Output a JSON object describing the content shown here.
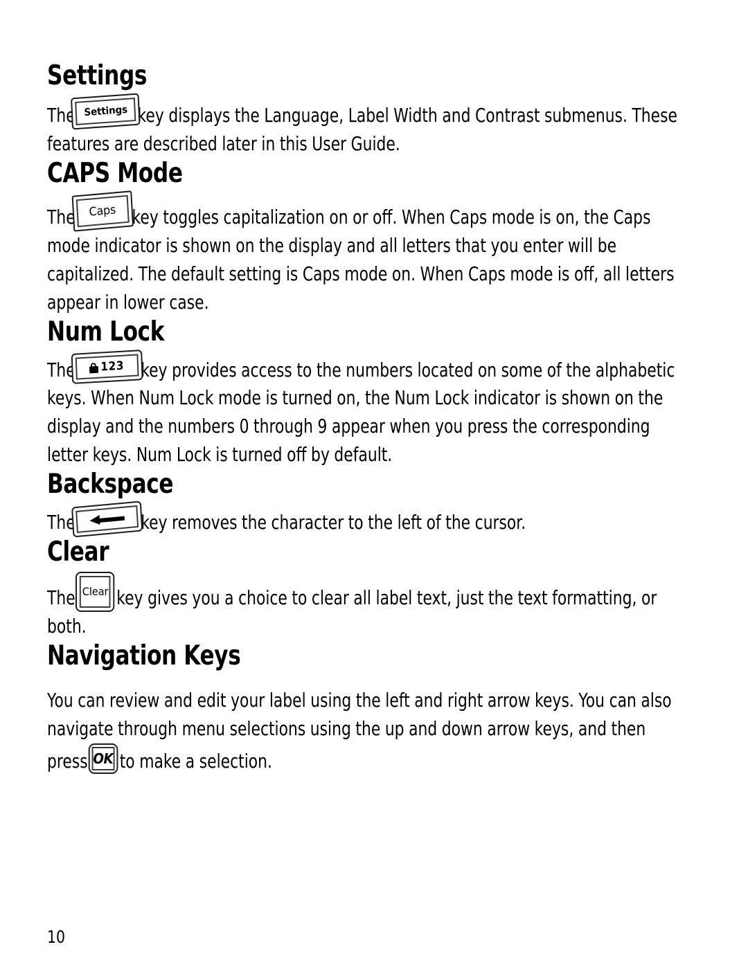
{
  "page": {
    "page_number": "10",
    "background_color": "#ffffff",
    "text_color": "#000000"
  },
  "sections": [
    {
      "id": "settings",
      "heading": "Settings",
      "key_icon": "settings-key-icon",
      "key_label": "Settings",
      "text_before": "The",
      "text_after": "key displays the Language, Label Width and Contrast submenus. These features are described later in this User Guide."
    },
    {
      "id": "caps-mode",
      "heading": "CAPS Mode",
      "key_icon": "caps-key-icon",
      "key_label": "Caps",
      "text_before": "The",
      "text_after": "key toggles capitalization on or off. When Caps mode is on, the Caps mode indicator is shown on the display and all letters that you enter will be capitalized. The default setting is Caps mode on. When Caps mode is off, all letters appear in lower case."
    },
    {
      "id": "num-lock",
      "heading": "Num Lock",
      "key_icon": "num-lock-key-icon",
      "key_label": "123",
      "text_before": "The",
      "text_after": "key provides access to the numbers located on some of the alphabetic keys. When Num Lock mode is turned on, the Num Lock indicator is shown on the display and the numbers 0 through 9 appear when you press the corresponding letter keys. Num Lock is turned off by default."
    },
    {
      "id": "backspace",
      "heading": "Backspace",
      "key_icon": "backspace-key-icon",
      "key_label": "",
      "text_before": "The",
      "text_after": "key removes the character to the left of the cursor."
    },
    {
      "id": "clear",
      "heading": "Clear",
      "key_icon": "clear-key-icon",
      "key_label": "Clear",
      "text_before": "The",
      "text_after": "key gives you a choice to clear all label text, just the text formatting, or both."
    },
    {
      "id": "navigation-keys",
      "heading": "Navigation Keys",
      "key_icon": "ok-key-icon",
      "key_label": "OK",
      "text_before": "You can review and edit your label using the left and right arrow keys. You can also navigate through menu selections using the up and down arrow keys, and then press",
      "text_after": "to make a selection."
    }
  ]
}
